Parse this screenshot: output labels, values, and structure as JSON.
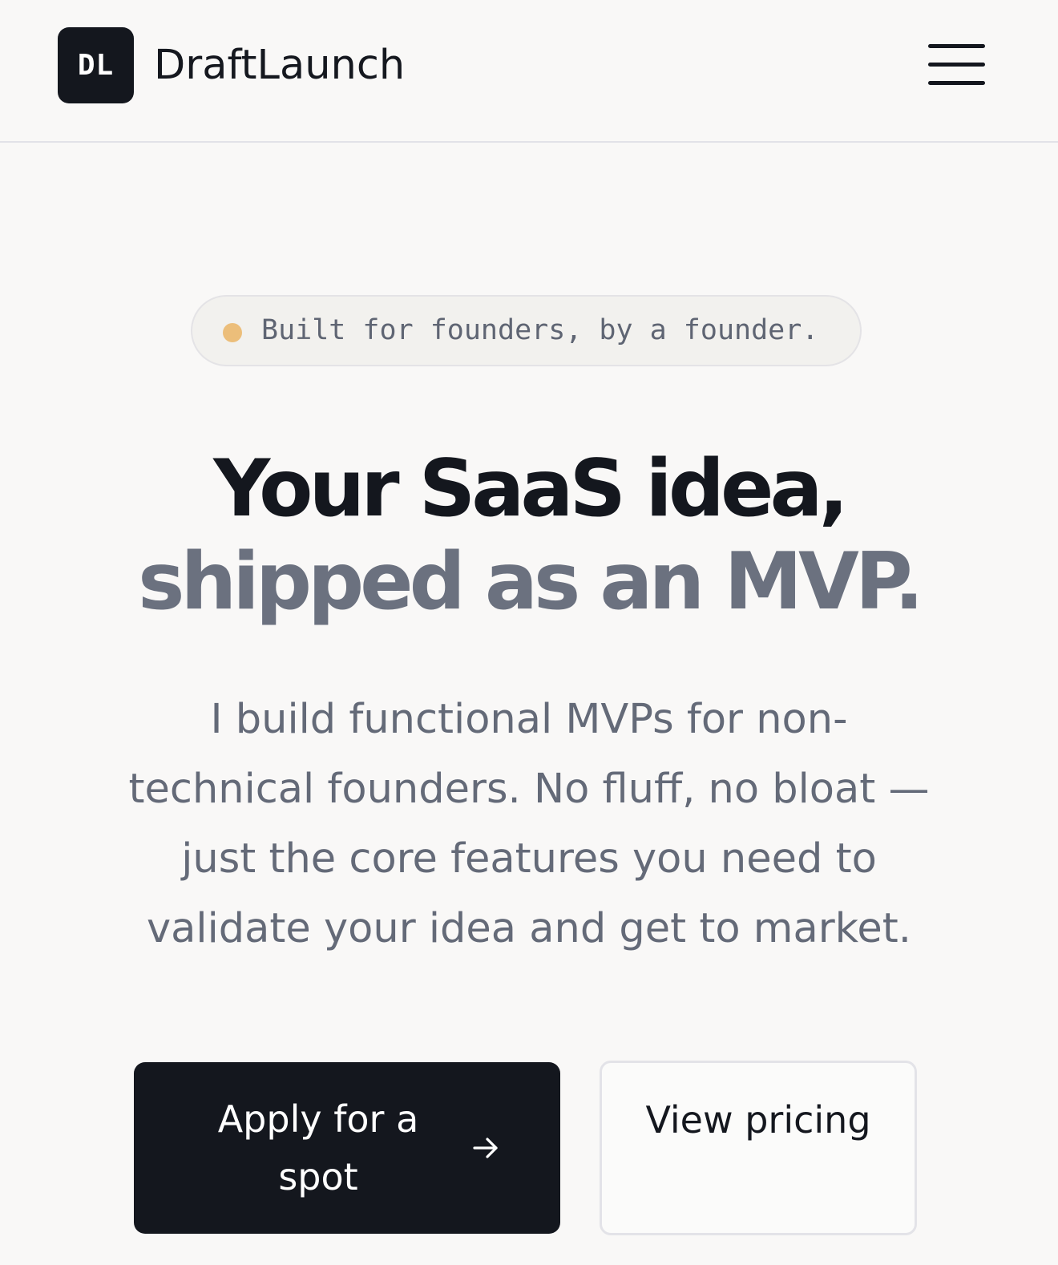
{
  "header": {
    "logo_initials": "DL",
    "brand_name": "DraftLaunch",
    "menu_icon": "hamburger-menu-icon"
  },
  "hero": {
    "badge": {
      "dot_color": "#ecbe7a",
      "text": "Built for founders, by a founder."
    },
    "headline": {
      "line_1": "Your SaaS idea,",
      "line_2": "shipped as an MVP."
    },
    "description": "I build functional MVPs for non-technical founders. No fluff, no bloat — just the core features you need to validate your idea and get to market.",
    "primary_cta": {
      "label": "Apply for a spot",
      "icon": "arrow-right-icon"
    },
    "secondary_cta": {
      "label": "View pricing"
    }
  },
  "colors": {
    "background": "#f9f8f7",
    "ink": "#14171e",
    "muted": "#6b717f",
    "accent_dot": "#ecbe7a"
  }
}
